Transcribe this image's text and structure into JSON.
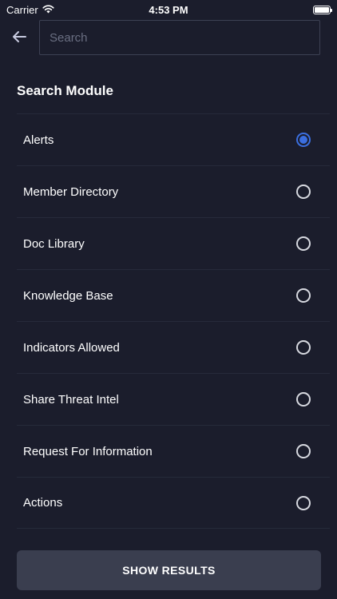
{
  "status_bar": {
    "carrier": "Carrier",
    "time": "4:53 PM",
    "wifi_icon": "wifi-icon",
    "battery_icon": "battery-icon"
  },
  "header": {
    "back_icon": "arrow-left-icon",
    "search_placeholder": "Search",
    "search_value": ""
  },
  "section": {
    "title": "Search Module",
    "options": [
      {
        "label": "Alerts",
        "selected": true
      },
      {
        "label": "Member Directory",
        "selected": false
      },
      {
        "label": "Doc Library",
        "selected": false
      },
      {
        "label": "Knowledge Base",
        "selected": false
      },
      {
        "label": "Indicators Allowed",
        "selected": false
      },
      {
        "label": "Share Threat Intel",
        "selected": false
      },
      {
        "label": "Request For Information",
        "selected": false
      },
      {
        "label": "Actions",
        "selected": false
      }
    ]
  },
  "footer": {
    "show_results_label": "SHOW RESULTS"
  },
  "colors": {
    "background": "#1b1d2c",
    "accent": "#3b6fe0",
    "button_bg": "#3a3e4f",
    "divider": "#262a3a"
  }
}
